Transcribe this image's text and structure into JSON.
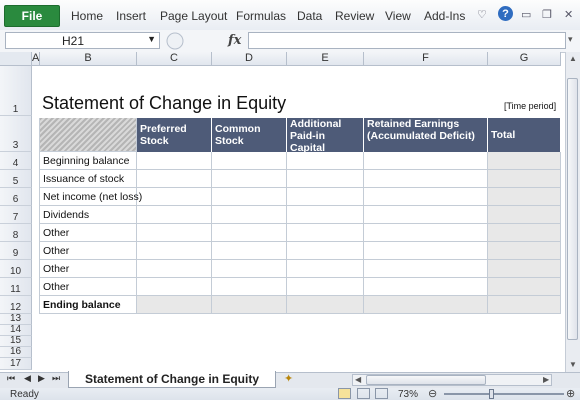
{
  "ribbon": {
    "file": "File",
    "tabs": [
      "Home",
      "Insert",
      "Page Layout",
      "Formulas",
      "Data",
      "Review",
      "View",
      "Add-Ins"
    ],
    "help": "?"
  },
  "formula_bar": {
    "name_box": "H21",
    "fx": "fx",
    "formula": ""
  },
  "columns": [
    "A",
    "B",
    "C",
    "D",
    "E",
    "F",
    "G"
  ],
  "rows": [
    "1",
    "3",
    "4",
    "5",
    "6",
    "7",
    "8",
    "9",
    "10",
    "11",
    "12",
    "13",
    "14",
    "15",
    "16",
    "17"
  ],
  "sheet": {
    "title": "Statement of Change in Equity",
    "period": "[Time period]",
    "headers": [
      "Preferred Stock",
      "Common Stock",
      "Additional Paid-in Capital",
      "Retained Earnings (Accumulated Deficit)",
      "Total"
    ],
    "row_labels": [
      "Beginning balance",
      "Issuance of stock",
      "Net income (net loss)",
      "Dividends",
      "Other",
      "Other",
      "Other",
      "Other",
      "Ending balance"
    ]
  },
  "tabs": {
    "sheet_name": "Statement of Change in Equity"
  },
  "status": {
    "ready": "Ready",
    "zoom": "73%"
  },
  "colors": {
    "header_fill": "#4e5b78",
    "total_fill": "#e8e8e8",
    "file_tab": "#2a8a3e"
  }
}
